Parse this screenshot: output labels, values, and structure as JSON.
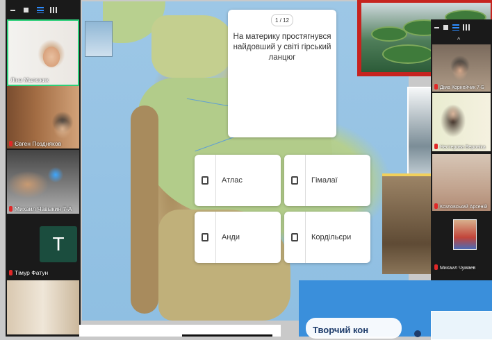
{
  "left_toolbar": {
    "minimize_icon": "minimize-icon",
    "stop_icon": "stop-icon",
    "speaker_view_icon": "speaker-view-icon",
    "gallery_view_icon": "gallery-view-icon"
  },
  "participants_left": [
    {
      "name": "Ліна Малежик",
      "muted": false
    },
    {
      "name": "Євген Поздняков",
      "muted": true
    },
    {
      "name": "Михаил Чавыкин 7-А",
      "muted": true
    },
    {
      "name": "Тімур Фатун",
      "muted": true,
      "avatar_letter": "T"
    },
    {
      "name": "",
      "muted": false
    }
  ],
  "quiz": {
    "counter": "1 / 12",
    "question": "На материку простягнувся найдовший у світі гірський ланцюг",
    "options": [
      "Атлас",
      "Гімалаї",
      "Анди",
      "Кордільєри"
    ]
  },
  "participants_right": [
    {
      "name": "Діма Корнейчик 7-Б",
      "muted": true
    },
    {
      "name": "Нестерова Вероніка",
      "muted": true
    },
    {
      "name": "Козловський Арсеній",
      "muted": true
    },
    {
      "name": "Михаил Чумаев",
      "muted": true
    }
  ],
  "bottom_right": {
    "title": "Творчий кон"
  },
  "colors": {
    "active_speaker_border": "#2ecf7a",
    "zoom_blue": "#2d8cff",
    "muted_red": "#e02828",
    "photo_border_red": "#c6231f"
  }
}
